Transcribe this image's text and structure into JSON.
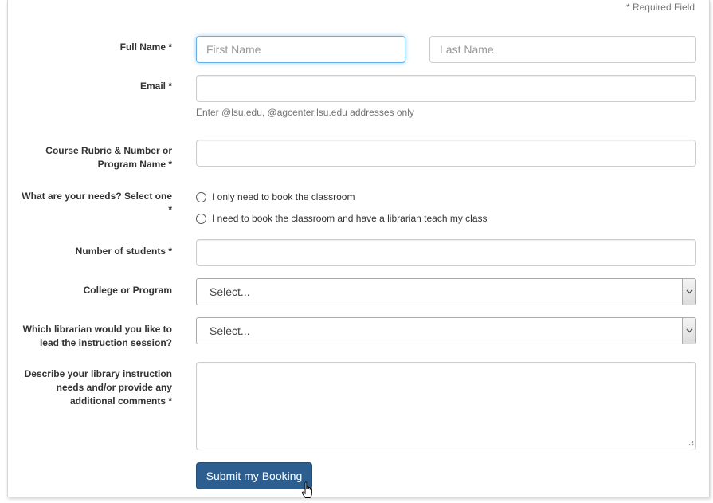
{
  "required_note": "* Required Field",
  "fields": {
    "full_name": {
      "label": "Full Name *",
      "first_placeholder": "First Name",
      "last_placeholder": "Last Name"
    },
    "email": {
      "label": "Email *",
      "placeholder": "",
      "help": "Enter @lsu.edu, @agcenter.lsu.edu addresses only"
    },
    "course": {
      "label_line1": "Course Rubric & Number or",
      "label_line2": "Program Name *",
      "placeholder": ""
    },
    "needs": {
      "label_line1": "What are your needs? Select one",
      "label_line2": "*",
      "options": [
        "I only need to book the classroom",
        "I need to book the classroom and have a librarian teach my class"
      ]
    },
    "students": {
      "label": "Number of students *",
      "placeholder": ""
    },
    "college": {
      "label": "College or Program",
      "selected": "Select..."
    },
    "librarian": {
      "label_line1": "Which librarian would you like to",
      "label_line2": "lead the instruction session?",
      "selected": "Select..."
    },
    "comments": {
      "label_line1": "Describe your library instruction",
      "label_line2": "needs and/or provide any",
      "label_line3": "additional comments *"
    }
  },
  "submit_label": "Submit my Booking",
  "colors": {
    "submit_bg": "#2c5e8f",
    "focus_border": "#66afe9"
  },
  "icons": {
    "select_arrow": "chevron-down-icon",
    "resize": "resize-grip-icon",
    "cursor": "hand-pointer-icon"
  }
}
